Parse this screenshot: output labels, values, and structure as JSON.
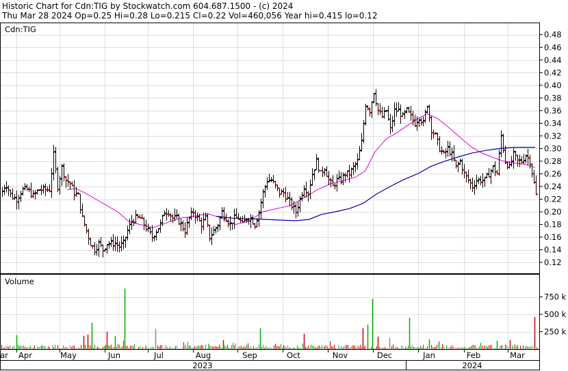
{
  "header": {
    "line1": "Historic Chart for Cdn:TIG by Stockwatch.com 604.687.1500 - (c) 2024",
    "line2": "Thu Mar 28 2024   Op=0.25   Hi=0.28   Lo=0.215   Cl=0.22   Vol=460,056   Year hi=0.415   lo=0.12"
  },
  "chart_data": [
    {
      "type": "ohlc",
      "symbol_label": "Cdn:TIG",
      "ylim": [
        0.1,
        0.5
      ],
      "y_ticks": [
        "0.48",
        "0.46",
        "0.44",
        "0.42",
        "0.40",
        "0.38",
        "0.36",
        "0.34",
        "0.32",
        "0.30",
        "0.28",
        "0.26",
        "0.24",
        "0.22",
        "0.20",
        "0.18",
        "0.16",
        "0.14",
        "0.12"
      ],
      "x_month_labels": [
        "ar",
        "Apr",
        "May",
        "Jun",
        "Jul",
        "Aug",
        "Sep",
        "Oct",
        "Nov",
        "Dec",
        "Jan",
        "Feb",
        "Mar"
      ],
      "x_year_labels": [
        "2023",
        "2024"
      ],
      "colors": {
        "up": "#000000",
        "down": "#cc0000",
        "ma_short": "#dd00dd",
        "ma_long": "#0000aa"
      },
      "close_anchors": [
        [
          0,
          0.225
        ],
        [
          8,
          0.245
        ],
        [
          16,
          0.225
        ],
        [
          24,
          0.22
        ],
        [
          32,
          0.235
        ],
        [
          40,
          0.235
        ],
        [
          48,
          0.225
        ],
        [
          56,
          0.235
        ],
        [
          64,
          0.235
        ],
        [
          72,
          0.235
        ],
        [
          78,
          0.29
        ],
        [
          84,
          0.24
        ],
        [
          90,
          0.27
        ],
        [
          96,
          0.25
        ],
        [
          102,
          0.245
        ],
        [
          108,
          0.23
        ],
        [
          114,
          0.225
        ],
        [
          120,
          0.19
        ],
        [
          126,
          0.17
        ],
        [
          132,
          0.15
        ],
        [
          138,
          0.14
        ],
        [
          144,
          0.15
        ],
        [
          150,
          0.14
        ],
        [
          156,
          0.15
        ],
        [
          162,
          0.15
        ],
        [
          168,
          0.15
        ],
        [
          174,
          0.145
        ],
        [
          180,
          0.15
        ],
        [
          186,
          0.17
        ],
        [
          192,
          0.185
        ],
        [
          198,
          0.19
        ],
        [
          204,
          0.19
        ],
        [
          210,
          0.18
        ],
        [
          216,
          0.17
        ],
        [
          222,
          0.16
        ],
        [
          228,
          0.17
        ],
        [
          234,
          0.18
        ],
        [
          240,
          0.2
        ],
        [
          246,
          0.2
        ],
        [
          252,
          0.19
        ],
        [
          258,
          0.19
        ],
        [
          264,
          0.18
        ],
        [
          270,
          0.17
        ],
        [
          276,
          0.19
        ],
        [
          282,
          0.2
        ],
        [
          288,
          0.19
        ],
        [
          294,
          0.18
        ],
        [
          300,
          0.19
        ],
        [
          306,
          0.16
        ],
        [
          312,
          0.17
        ],
        [
          318,
          0.18
        ],
        [
          324,
          0.2
        ],
        [
          330,
          0.19
        ],
        [
          336,
          0.18
        ],
        [
          342,
          0.19
        ],
        [
          348,
          0.19
        ],
        [
          354,
          0.18
        ],
        [
          360,
          0.19
        ],
        [
          366,
          0.19
        ],
        [
          372,
          0.18
        ],
        [
          378,
          0.2
        ],
        [
          384,
          0.23
        ],
        [
          390,
          0.25
        ],
        [
          396,
          0.25
        ],
        [
          402,
          0.24
        ],
        [
          408,
          0.23
        ],
        [
          414,
          0.23
        ],
        [
          420,
          0.22
        ],
        [
          426,
          0.21
        ],
        [
          432,
          0.2
        ],
        [
          438,
          0.22
        ],
        [
          444,
          0.24
        ],
        [
          450,
          0.23
        ],
        [
          456,
          0.26
        ],
        [
          462,
          0.28
        ],
        [
          468,
          0.26
        ],
        [
          474,
          0.27
        ],
        [
          480,
          0.25
        ],
        [
          486,
          0.24
        ],
        [
          492,
          0.25
        ],
        [
          498,
          0.25
        ],
        [
          504,
          0.26
        ],
        [
          510,
          0.26
        ],
        [
          516,
          0.27
        ],
        [
          522,
          0.28
        ],
        [
          528,
          0.31
        ],
        [
          534,
          0.37
        ],
        [
          540,
          0.36
        ],
        [
          546,
          0.39
        ],
        [
          552,
          0.36
        ],
        [
          558,
          0.35
        ],
        [
          564,
          0.36
        ],
        [
          570,
          0.33
        ],
        [
          576,
          0.36
        ],
        [
          582,
          0.36
        ],
        [
          588,
          0.35
        ],
        [
          594,
          0.36
        ],
        [
          600,
          0.35
        ],
        [
          606,
          0.34
        ],
        [
          612,
          0.35
        ],
        [
          618,
          0.34
        ],
        [
          624,
          0.37
        ],
        [
          630,
          0.33
        ],
        [
          636,
          0.32
        ],
        [
          642,
          0.3
        ],
        [
          648,
          0.29
        ],
        [
          654,
          0.3
        ],
        [
          660,
          0.29
        ],
        [
          666,
          0.27
        ],
        [
          672,
          0.28
        ],
        [
          678,
          0.26
        ],
        [
          684,
          0.25
        ],
        [
          690,
          0.24
        ],
        [
          696,
          0.25
        ],
        [
          702,
          0.25
        ],
        [
          708,
          0.25
        ],
        [
          714,
          0.26
        ],
        [
          720,
          0.27
        ],
        [
          726,
          0.26
        ],
        [
          732,
          0.32
        ],
        [
          738,
          0.28
        ],
        [
          744,
          0.27
        ],
        [
          750,
          0.29
        ],
        [
          756,
          0.28
        ],
        [
          762,
          0.28
        ],
        [
          768,
          0.29
        ],
        [
          774,
          0.28
        ],
        [
          780,
          0.245
        ],
        [
          784,
          0.22
        ]
      ],
      "ma_short_anchors": [
        [
          98,
          0.235
        ],
        [
          110,
          0.237
        ],
        [
          124,
          0.23
        ],
        [
          140,
          0.22
        ],
        [
          156,
          0.21
        ],
        [
          172,
          0.2
        ],
        [
          188,
          0.185
        ],
        [
          204,
          0.18
        ],
        [
          224,
          0.175
        ],
        [
          244,
          0.183
        ],
        [
          264,
          0.19
        ],
        [
          284,
          0.193
        ],
        [
          304,
          0.197
        ],
        [
          324,
          0.19
        ],
        [
          344,
          0.18
        ],
        [
          364,
          0.185
        ],
        [
          384,
          0.2
        ],
        [
          404,
          0.205
        ],
        [
          424,
          0.21
        ],
        [
          444,
          0.222
        ],
        [
          464,
          0.235
        ],
        [
          484,
          0.245
        ],
        [
          504,
          0.25
        ],
        [
          520,
          0.255
        ],
        [
          534,
          0.265
        ],
        [
          548,
          0.295
        ],
        [
          564,
          0.315
        ],
        [
          580,
          0.325
        ],
        [
          596,
          0.337
        ],
        [
          610,
          0.347
        ],
        [
          624,
          0.355
        ],
        [
          640,
          0.347
        ],
        [
          656,
          0.333
        ],
        [
          672,
          0.318
        ],
        [
          688,
          0.303
        ],
        [
          704,
          0.293
        ],
        [
          720,
          0.286
        ],
        [
          736,
          0.28
        ],
        [
          752,
          0.277
        ],
        [
          768,
          0.275
        ],
        [
          782,
          0.27
        ]
      ],
      "ma_long_anchors": [
        [
          316,
          0.193
        ],
        [
          340,
          0.19
        ],
        [
          364,
          0.189
        ],
        [
          388,
          0.188
        ],
        [
          410,
          0.187
        ],
        [
          432,
          0.186
        ],
        [
          452,
          0.188
        ],
        [
          470,
          0.196
        ],
        [
          490,
          0.2
        ],
        [
          510,
          0.205
        ],
        [
          530,
          0.213
        ],
        [
          550,
          0.228
        ],
        [
          570,
          0.24
        ],
        [
          590,
          0.251
        ],
        [
          610,
          0.26
        ],
        [
          630,
          0.272
        ],
        [
          650,
          0.28
        ],
        [
          670,
          0.287
        ],
        [
          690,
          0.293
        ],
        [
          710,
          0.297
        ],
        [
          730,
          0.3
        ],
        [
          750,
          0.302
        ],
        [
          782,
          0.302
        ]
      ]
    },
    {
      "type": "bar",
      "title": "Volume",
      "y_ticks": [
        "750 k",
        "500 k",
        "250 k"
      ],
      "ylim": [
        0,
        1000
      ],
      "x_range": [
        0,
        788
      ],
      "spikes": [
        {
          "x": 182,
          "value": 870,
          "color": "#00aa00"
        },
        {
          "x": 544,
          "value": 720,
          "color": "#00aa00"
        },
        {
          "x": 598,
          "value": 450,
          "color": "#00aa00"
        },
        {
          "x": 781,
          "value": 460,
          "color": "#cc0000"
        },
        {
          "x": 134,
          "value": 380,
          "color": "#00aa00"
        },
        {
          "x": 380,
          "value": 300,
          "color": "#00aa00"
        },
        {
          "x": 537,
          "value": 350,
          "color": "#00aa00"
        },
        {
          "x": 530,
          "value": 300,
          "color": "#cc0000"
        },
        {
          "x": 227,
          "value": 290,
          "color": "#888888"
        },
        {
          "x": 156,
          "value": 250,
          "color": "#cc0000"
        },
        {
          "x": 122,
          "value": 190,
          "color": "#cc0000"
        },
        {
          "x": 128,
          "value": 210,
          "color": "#cc0000"
        },
        {
          "x": 168,
          "value": 190,
          "color": "#00aa00"
        },
        {
          "x": 24,
          "value": 200,
          "color": "#00aa00"
        },
        {
          "x": 444,
          "value": 220,
          "color": "#cc0000"
        },
        {
          "x": 569,
          "value": 160,
          "color": "#888888"
        },
        {
          "x": 552,
          "value": 180,
          "color": "#cc0000"
        },
        {
          "x": 326,
          "value": 130,
          "color": "#cc0000"
        },
        {
          "x": 627,
          "value": 140,
          "color": "#00aa00"
        },
        {
          "x": 641,
          "value": 110,
          "color": "#00aa00"
        },
        {
          "x": 726,
          "value": 120,
          "color": "#00aa00"
        },
        {
          "x": 745,
          "value": 130,
          "color": "#cc0000"
        }
      ]
    }
  ]
}
